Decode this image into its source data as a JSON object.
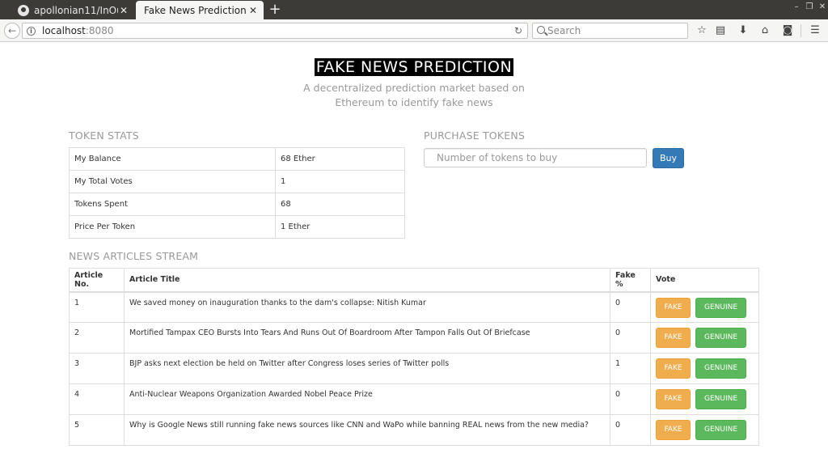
{
  "browser": {
    "tabs": [
      {
        "title": "apollonian11/InOut…",
        "close": "✕"
      },
      {
        "title": "Fake News Prediction",
        "close": "✕"
      }
    ],
    "new_tab": "+",
    "url_host": "localhost",
    "url_port": ":8080",
    "search_placeholder": "Search"
  },
  "page": {
    "title": "FAKE NEWS PREDICTION",
    "subtitle": "A decentralized prediction market based on Ethereum to identify fake news"
  },
  "token_stats": {
    "heading": "TOKEN STATS",
    "rows": [
      {
        "label": "My Balance",
        "value": "68 Ether"
      },
      {
        "label": "My Total Votes",
        "value": "1"
      },
      {
        "label": "Tokens Spent",
        "value": "68"
      },
      {
        "label": "Price Per Token",
        "value": "1 Ether"
      }
    ]
  },
  "purchase": {
    "heading": "PURCHASE TOKENS",
    "placeholder": "Number of tokens to buy",
    "button": "Buy"
  },
  "news": {
    "heading": "NEWS ARTICLES STREAM",
    "columns": [
      "Article No.",
      "Article Title",
      "Fake %",
      "Vote"
    ],
    "fake_label": "FAKE",
    "genuine_label": "GENUINE",
    "articles": [
      {
        "no": "1",
        "title": "We saved money on inauguration thanks to the dam's collapse: Nitish Kumar",
        "fake": "0"
      },
      {
        "no": "2",
        "title": "Mortified Tampax CEO Bursts Into Tears And Runs Out Of Boardroom After Tampon Falls Out Of Briefcase",
        "fake": "0"
      },
      {
        "no": "3",
        "title": "BJP asks next election be held on Twitter after Congress loses series of Twitter polls",
        "fake": "1"
      },
      {
        "no": "4",
        "title": "Anti-Nuclear Weapons Organization Awarded Nobel Peace Prize",
        "fake": "0"
      },
      {
        "no": "5",
        "title": "Why is Google News still running fake news sources like CNN and WaPo while banning REAL news from the new media?",
        "fake": "0"
      }
    ]
  },
  "colors": {
    "primary": "#337ab7",
    "fake_button": "#f0ad4e",
    "genuine_button": "#5cb85c",
    "heading_gray": "#999999"
  }
}
